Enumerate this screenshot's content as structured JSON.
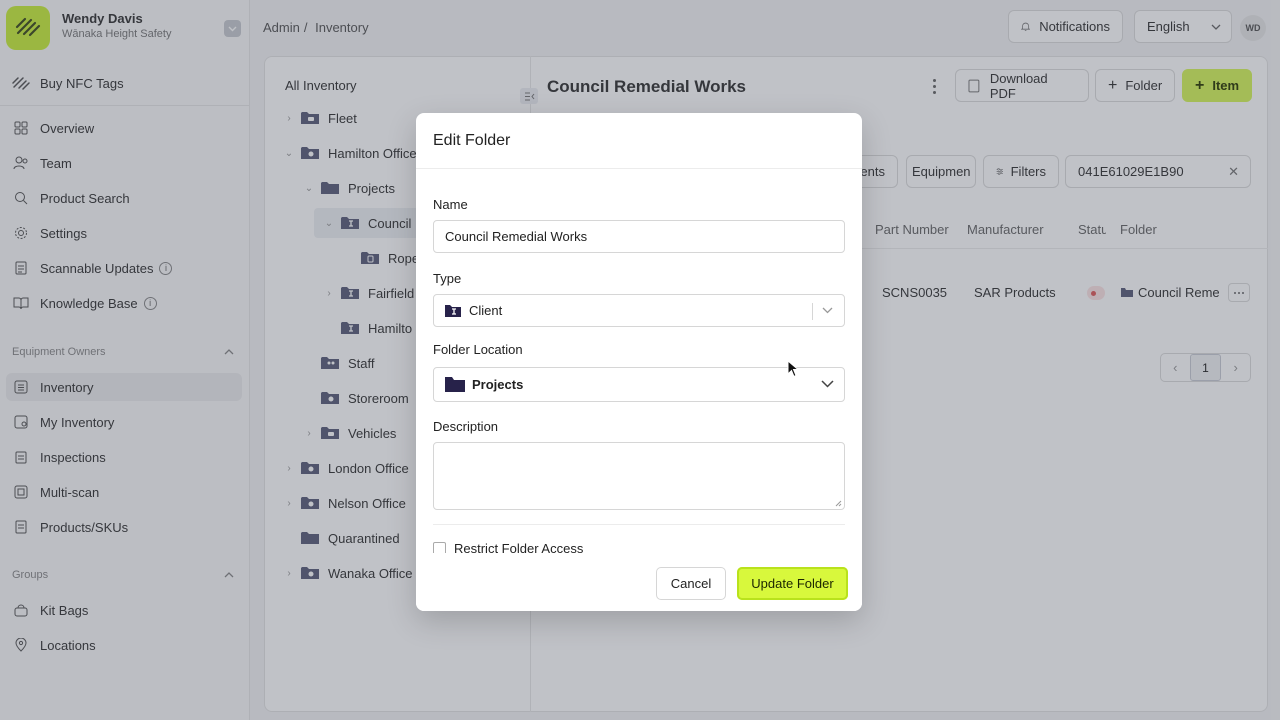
{
  "user": {
    "name": "Wendy Davis",
    "org": "Wānaka Height Safety",
    "initials": "WD"
  },
  "sidebar": {
    "promo": "Buy NFC Tags",
    "main_items": [
      {
        "label": "Overview",
        "icon": "grid-icon"
      },
      {
        "label": "Team",
        "icon": "users-icon"
      },
      {
        "label": "Product Search",
        "icon": "search-icon"
      },
      {
        "label": "Settings",
        "icon": "gear-icon"
      },
      {
        "label": "Scannable Updates",
        "icon": "document-icon"
      },
      {
        "label": "Knowledge Base",
        "icon": "book-icon"
      }
    ],
    "section_owners": "Equipment Owners",
    "owner_items": [
      {
        "label": "Inventory",
        "icon": "list-icon"
      },
      {
        "label": "My Inventory",
        "icon": "user-list-icon"
      },
      {
        "label": "Inspections",
        "icon": "clipboard-icon"
      },
      {
        "label": "Multi-scan",
        "icon": "scan-icon"
      },
      {
        "label": "Products/SKUs",
        "icon": "tag-icon"
      }
    ],
    "section_groups": "Groups",
    "group_items": [
      {
        "label": "Kit Bags",
        "icon": "bag-icon"
      },
      {
        "label": "Locations",
        "icon": "pin-icon"
      }
    ]
  },
  "breadcrumb": {
    "root": "Admin",
    "sep": "/",
    "current": "Inventory"
  },
  "topbar": {
    "notifications": "Notifications",
    "language": "English"
  },
  "tree": {
    "header": "All Inventory",
    "items": [
      {
        "label": "Fleet"
      },
      {
        "label": "Hamilton Office"
      },
      {
        "label": "Projects"
      },
      {
        "label": "Council"
      },
      {
        "label": "Rope"
      },
      {
        "label": "Fairfield"
      },
      {
        "label": "Hamilto"
      },
      {
        "label": "Staff"
      },
      {
        "label": "Storeroom"
      },
      {
        "label": "Vehicles"
      },
      {
        "label": "London Office"
      },
      {
        "label": "Nelson Office"
      },
      {
        "label": "Quarantined"
      },
      {
        "label": "Wanaka Office"
      }
    ]
  },
  "panel": {
    "title": "Council Remedial Works",
    "download_pdf": "Download PDF",
    "folder_btn": "Folder",
    "item_btn": "Item",
    "filter_clients": "lients",
    "filter_equipment": "Equipmen",
    "filters": "Filters",
    "search_value": "041E61029E1B90",
    "columns": [
      "Part Number",
      "Manufacturer",
      "Statu",
      "Folder"
    ],
    "row": {
      "part_number": "SCNS0035",
      "manufacturer": "SAR Products",
      "folder": "Council Reme"
    },
    "page": "1"
  },
  "modal": {
    "title": "Edit Folder",
    "name_label": "Name",
    "name_value": "Council Remedial Works",
    "type_label": "Type",
    "type_value": "Client",
    "location_label": "Folder Location",
    "location_value": "Projects",
    "description_label": "Description",
    "description_value": "",
    "restrict_label": "Restrict Folder Access",
    "cancel": "Cancel",
    "update": "Update Folder"
  },
  "colors": {
    "accent": "#d8f83c",
    "folder": "#5b5e7a",
    "folder_dark": "#27224a"
  }
}
